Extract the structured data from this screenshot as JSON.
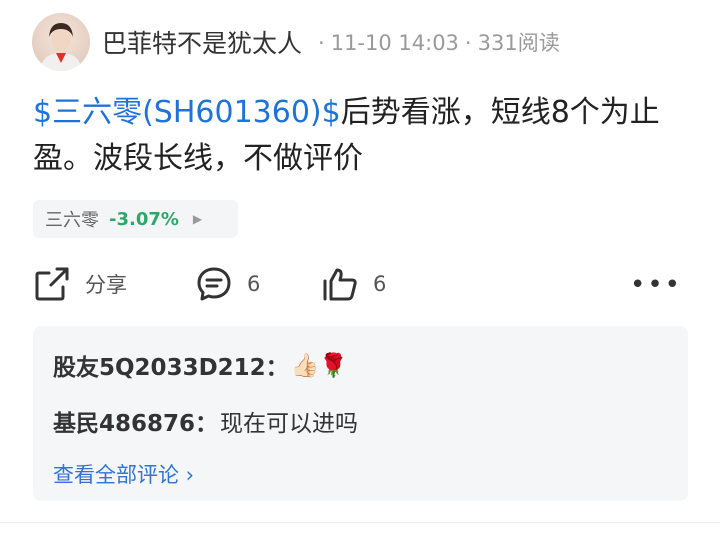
{
  "post": {
    "author": "巴菲特不是犹太人",
    "time": "11-10 14:03",
    "views": "331阅读",
    "stock_tag": "$三六零(SH601360)$",
    "text": "后势看涨，短线8个为止盈。波段长线，不做评价"
  },
  "stock_chip": {
    "name": "三六零",
    "change": "-3.07%",
    "change_color": "#2da86b",
    "arrow_icon": "play-right-icon"
  },
  "actions": {
    "share_label": "分享",
    "comment_count": "6",
    "like_count": "6",
    "more_icon": "ellipsis-icon"
  },
  "comments": {
    "items": [
      {
        "user": "股友5Q2033D212：",
        "text": "👍🏻🌹"
      },
      {
        "user": "基民486876：",
        "text": "现在可以进吗"
      }
    ],
    "view_all": "查看全部评论 ›"
  },
  "colors": {
    "link_blue": "#1e73d8",
    "comment_bg": "#f5f6f8"
  }
}
